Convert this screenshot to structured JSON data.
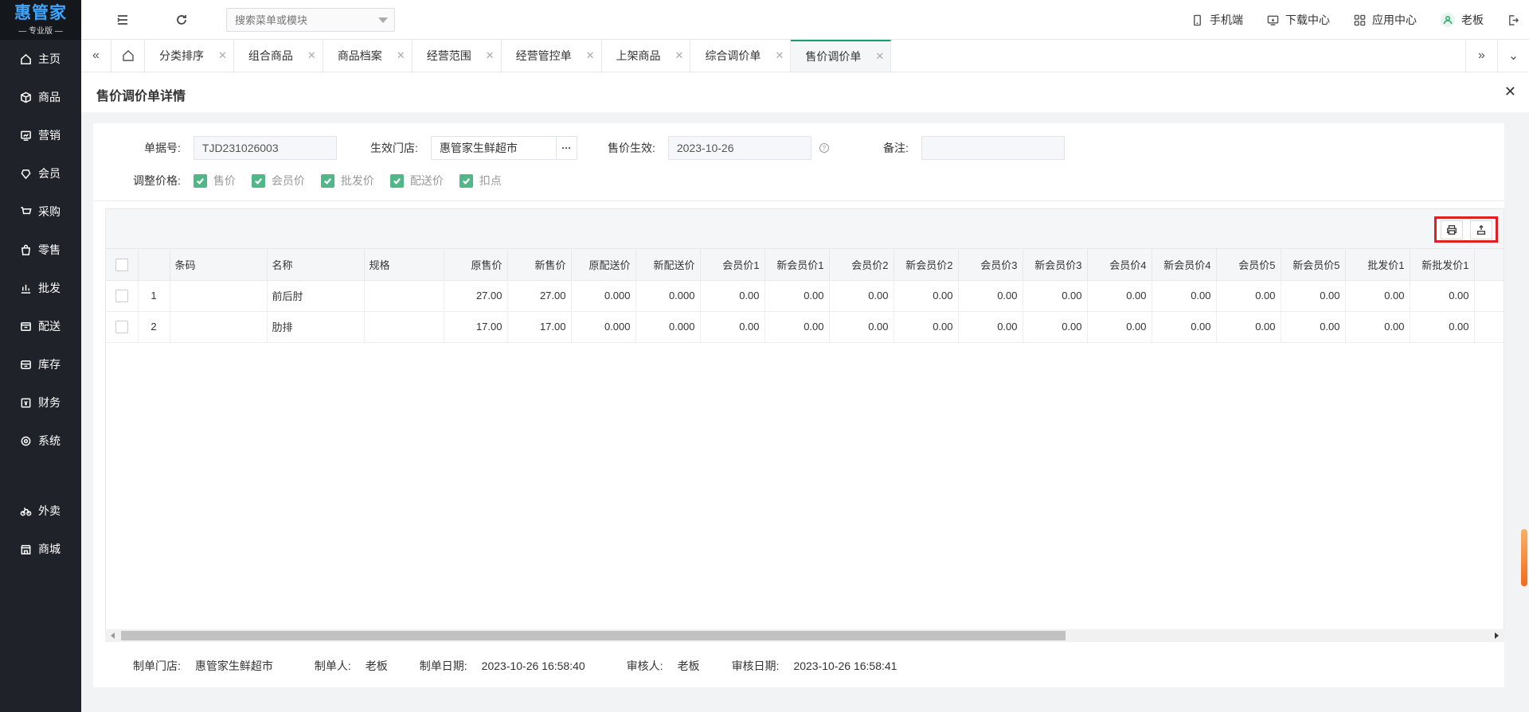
{
  "app": {
    "logo": "惠管家",
    "edition": "— 专业版 —"
  },
  "sidebar": {
    "items": [
      {
        "label": "主页",
        "icon": "home-icon"
      },
      {
        "label": "商品",
        "icon": "box-icon"
      },
      {
        "label": "营销",
        "icon": "marketing-icon"
      },
      {
        "label": "会员",
        "icon": "member-icon"
      },
      {
        "label": "采购",
        "icon": "cart-icon"
      },
      {
        "label": "零售",
        "icon": "bag-icon"
      },
      {
        "label": "批发",
        "icon": "chart-icon"
      },
      {
        "label": "配送",
        "icon": "delivery-icon"
      },
      {
        "label": "库存",
        "icon": "stock-icon"
      },
      {
        "label": "财务",
        "icon": "finance-icon"
      },
      {
        "label": "系统",
        "icon": "system-icon"
      }
    ],
    "extra": [
      {
        "label": "外卖",
        "icon": "bike-icon"
      },
      {
        "label": "商城",
        "icon": "store-icon"
      }
    ]
  },
  "topbar": {
    "search_placeholder": "搜索菜单或模块",
    "mobile": "手机端",
    "download": "下载中心",
    "apps": "应用中心",
    "user": "老板"
  },
  "tabs": [
    {
      "label": "分类排序",
      "active": false
    },
    {
      "label": "组合商品",
      "active": false
    },
    {
      "label": "商品档案",
      "active": false
    },
    {
      "label": "经营范围",
      "active": false
    },
    {
      "label": "经营管控单",
      "active": false
    },
    {
      "label": "上架商品",
      "active": false
    },
    {
      "label": "综合调价单",
      "active": false
    },
    {
      "label": "售价调价单",
      "active": true
    }
  ],
  "page": {
    "title": "售价调价单详情",
    "form": {
      "doc_no_label": "单据号:",
      "doc_no": "TJD231026003",
      "store_label": "生效门店:",
      "store": "惠管家生鲜超市",
      "effective_label": "售价生效:",
      "effective_date": "2023-10-26",
      "remark_label": "备注:",
      "remark": "",
      "adjust_label": "调整价格:",
      "adjust_options": [
        "售价",
        "会员价",
        "批发价",
        "配送价",
        "扣点"
      ]
    },
    "table": {
      "columns": [
        "条码",
        "名称",
        "规格",
        "原售价",
        "新售价",
        "原配送价",
        "新配送价",
        "会员价1",
        "新会员价1",
        "会员价2",
        "新会员价2",
        "会员价3",
        "新会员价3",
        "会员价4",
        "新会员价4",
        "会员价5",
        "新会员价5",
        "批发价1",
        "新批发价1"
      ],
      "rows": [
        {
          "no": "1",
          "barcode": "",
          "name": "前后肘",
          "spec": "",
          "values": [
            "27.00",
            "27.00",
            "0.000",
            "0.000",
            "0.00",
            "0.00",
            "0.00",
            "0.00",
            "0.00",
            "0.00",
            "0.00",
            "0.00",
            "0.00",
            "0.00",
            "0.00",
            "0.00"
          ]
        },
        {
          "no": "2",
          "barcode": "",
          "name": "肋排",
          "spec": "",
          "values": [
            "17.00",
            "17.00",
            "0.000",
            "0.000",
            "0.00",
            "0.00",
            "0.00",
            "0.00",
            "0.00",
            "0.00",
            "0.00",
            "0.00",
            "0.00",
            "0.00",
            "0.00",
            "0.00"
          ]
        }
      ]
    },
    "footer": {
      "store_label": "制单门店:",
      "store": "惠管家生鲜超市",
      "maker_label": "制单人:",
      "maker": "老板",
      "make_date_label": "制单日期:",
      "make_date": "2023-10-26 16:58:40",
      "auditor_label": "审核人:",
      "auditor": "老板",
      "audit_date_label": "审核日期:",
      "audit_date": "2023-10-26 16:58:41"
    }
  }
}
